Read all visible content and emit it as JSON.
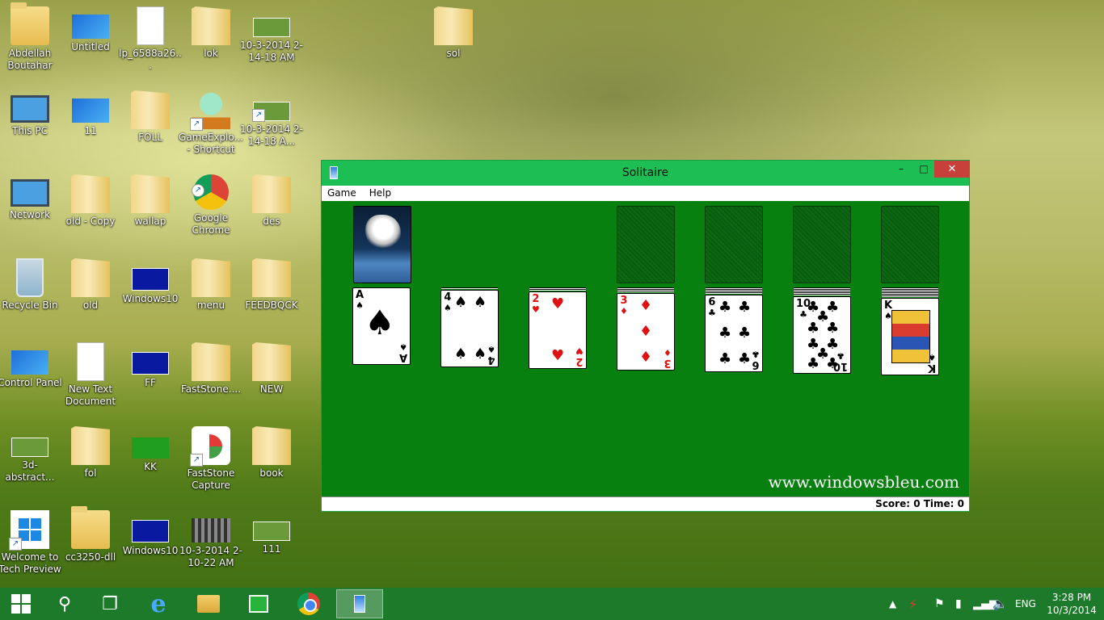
{
  "desktop": {
    "icons": [
      {
        "label": "Abdellah Boutahar"
      },
      {
        "label": "Untitled"
      },
      {
        "label": "lp_6588a26..."
      },
      {
        "label": "lok"
      },
      {
        "label": "10-3-2014 2-14-18 AM"
      },
      {
        "label": "sol"
      },
      {
        "label": "This PC"
      },
      {
        "label": "11"
      },
      {
        "label": "FOLL"
      },
      {
        "label": "GameExplo... - Shortcut"
      },
      {
        "label": "10-3-2014 2-14-18 A..."
      },
      {
        "label": "Network"
      },
      {
        "label": "old - Copy"
      },
      {
        "label": "wallap"
      },
      {
        "label": "Google Chrome"
      },
      {
        "label": "des"
      },
      {
        "label": "Recycle Bin"
      },
      {
        "label": "old"
      },
      {
        "label": "Windows10"
      },
      {
        "label": "menu"
      },
      {
        "label": "FEEDBQCK"
      },
      {
        "label": "Control Panel"
      },
      {
        "label": "New Text Document"
      },
      {
        "label": "FF"
      },
      {
        "label": "FastStone...."
      },
      {
        "label": "NEW"
      },
      {
        "label": "3d-abstract..."
      },
      {
        "label": "fol"
      },
      {
        "label": "KK"
      },
      {
        "label": "FastStone Capture"
      },
      {
        "label": "book"
      },
      {
        "label": "Welcome to Tech Preview"
      },
      {
        "label": "cc3250-dll"
      },
      {
        "label": "Windows10"
      },
      {
        "label": "10-3-2014 2-10-22 AM"
      },
      {
        "label": "111"
      }
    ]
  },
  "window": {
    "title": "Solitaire",
    "controls": {
      "minimize": "–",
      "maximize": "□",
      "close": "✕"
    },
    "menu": [
      "Game",
      "Help"
    ],
    "watermark": "www.windowsbleu.com",
    "status": "Score: 0 Time: 0"
  },
  "cards": {
    "waste_ace": {
      "rank": "A",
      "suit": "♠"
    },
    "tableau": [
      {
        "rank": "4",
        "suit": "♠",
        "color": "black"
      },
      {
        "rank": "2",
        "suit": "♥",
        "color": "red"
      },
      {
        "rank": "3",
        "suit": "♦",
        "color": "red"
      },
      {
        "rank": "6",
        "suit": "♣",
        "color": "black"
      },
      {
        "rank": "10",
        "suit": "♣",
        "color": "black"
      },
      {
        "rank": "K",
        "suit": "♠",
        "color": "black"
      }
    ]
  },
  "taskbar": {
    "tray_lang": "ENG",
    "tray_arrow": "▲",
    "clock_time": "3:28 PM",
    "clock_date": "10/3/2014"
  },
  "colors": {
    "taskbar": "#1d7a2a",
    "titlebar": "#1dbf55",
    "felt": "#088010",
    "close": "#c7403a"
  }
}
